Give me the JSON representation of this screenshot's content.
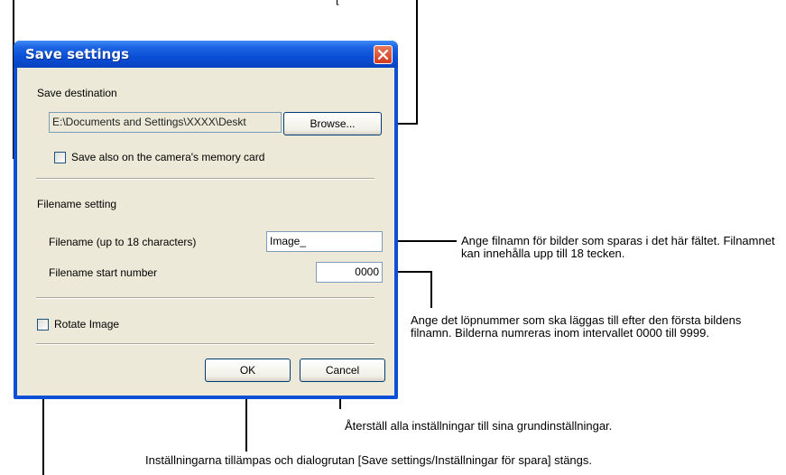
{
  "dialog": {
    "title": "Save settings",
    "save_destination_label": "Save destination",
    "path_value": "E:\\Documents and Settings\\XXXX\\Deskt",
    "browse_label": "Browse...",
    "save_on_card_label": "Save also on the camera's memory card",
    "save_on_card_checked": false,
    "filename_setting_label": "Filename setting",
    "filename_label": "Filename (up to 18 characters)",
    "filename_value": "Image_",
    "start_number_label": "Filename start number",
    "start_number_value": "0000",
    "rotate_label": "Rotate Image",
    "rotate_checked": false,
    "ok_label": "OK",
    "cancel_label": "Cancel"
  },
  "annotations": {
    "filename_note": "Ange filnamn för bilder som sparas i det här fältet. Filnamnet kan innehålla upp till 18 tecken.",
    "start_number_note": "Ange det löpnummer som ska läggas till efter den första bildens filnamn. Bilderna numreras inom intervallet 0000 till 9999.",
    "cancel_note": "Återställ alla inställningar till sina grundinställningar.",
    "ok_note": "Inställningarna tillämpas och dialogrutan [Save settings/Inställningar för spara] stängs."
  }
}
